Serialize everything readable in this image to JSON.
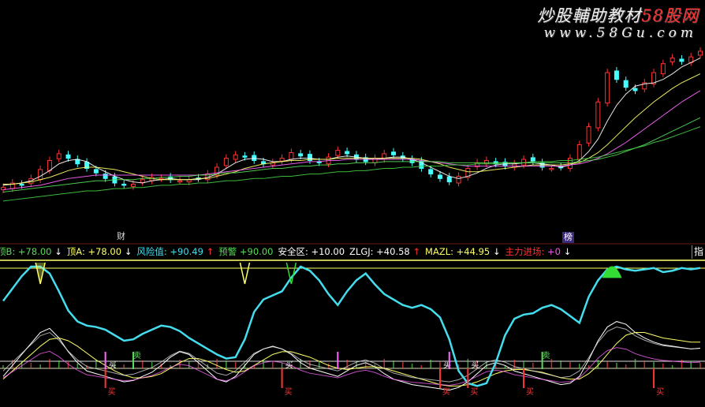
{
  "watermark": {
    "title_main": "炒股輔助教材",
    "title_accent": "58股网",
    "url": "www.58Gu.com"
  },
  "markers": {
    "cai": "财",
    "bang": "榜"
  },
  "indicator_bar": {
    "items": [
      {
        "label": "顶B:",
        "value": "+78.00",
        "arrow": "↓",
        "color": "#55dd55",
        "value_color": "#55dd55",
        "arrow_color": "#ffffff"
      },
      {
        "label": "顶A:",
        "value": "+78.00",
        "arrow": "↓",
        "color": "#ffff66",
        "value_color": "#ffff66",
        "arrow_color": "#ffffff"
      },
      {
        "label": "风险值:",
        "value": "+90.49",
        "arrow": "↑",
        "color": "#44ddee",
        "value_color": "#44ddee",
        "arrow_color": "#ff3333"
      },
      {
        "label": "预警",
        "value": "+90.00",
        "arrow": "",
        "color": "#55dd55",
        "value_color": "#55dd55",
        "arrow_color": ""
      },
      {
        "label": "安全区:",
        "value": "+10.00",
        "arrow": "",
        "color": "#ffffff",
        "value_color": "#ffffff",
        "arrow_color": ""
      },
      {
        "label": "ZLGJ:",
        "value": "+40.58",
        "arrow": "↑",
        "color": "#ffffff",
        "value_color": "#ffffff",
        "arrow_color": "#ff3333"
      },
      {
        "label": "MAZL:",
        "value": "+44.95",
        "arrow": "↓",
        "color": "#ffff66",
        "value_color": "#ffff66",
        "arrow_color": "#ffffff"
      },
      {
        "label": "主力进场:",
        "value": "+0",
        "arrow": "↓",
        "color": "#ff3333",
        "value_color": "#ff55ff",
        "arrow_color": "#ffffff"
      }
    ],
    "right_tab": "指"
  },
  "signal_labels": {
    "buy": "买",
    "sell": "卖"
  },
  "colors": {
    "up": "#ff3333",
    "down": "#44ffff",
    "ma5": "#ffffff",
    "ma10": "#ffff66",
    "ma20": "#ff66ff",
    "ma30": "#55dd55",
    "ma60": "#44cc44",
    "risk": "#44ddee",
    "threshold_line": "#ffff66"
  },
  "chart_data": [
    {
      "type": "candlestick",
      "title": "",
      "series": [
        {
          "name": "price",
          "values": [
            10.2,
            10.6,
            10.4,
            11.0,
            11.8,
            12.6,
            13.2,
            12.8,
            12.3,
            11.9,
            11.5,
            11.0,
            10.6,
            10.4,
            10.5,
            10.9,
            11.1,
            11.0,
            10.9,
            10.8,
            10.9,
            11.0,
            11.4,
            12.0,
            12.8,
            13.1,
            12.9,
            12.6,
            12.3,
            12.4,
            12.8,
            13.3,
            13.0,
            12.6,
            12.4,
            12.9,
            13.5,
            13.2,
            12.7,
            12.5,
            12.8,
            13.2,
            13.1,
            12.8,
            12.4,
            11.9,
            11.4,
            11.0,
            10.7,
            11.2,
            11.9,
            12.4,
            12.6,
            12.3,
            12.1,
            12.3,
            12.7,
            12.5,
            12.0,
            11.9,
            12.0,
            12.8,
            14.0,
            15.6,
            17.8,
            20.4,
            19.8,
            19.1,
            18.8,
            19.5,
            20.4,
            21.2,
            21.7,
            21.4,
            21.8,
            22.3
          ]
        },
        {
          "name": "MA5",
          "values": [
            10.4,
            10.5,
            10.6,
            10.8,
            11.2,
            11.7,
            12.3,
            12.6,
            12.7,
            12.5,
            12.0,
            11.6,
            11.2,
            10.9,
            10.7,
            10.6,
            10.8,
            10.9,
            11.0,
            10.9,
            10.9,
            10.9,
            11.1,
            11.4,
            11.9,
            12.4,
            12.7,
            12.8,
            12.7,
            12.5,
            12.5,
            12.7,
            12.8,
            12.8,
            12.7,
            12.7,
            12.9,
            13.0,
            12.9,
            12.8,
            12.7,
            12.8,
            12.9,
            12.9,
            12.7,
            12.4,
            12.0,
            11.6,
            11.2,
            11.0,
            11.2,
            11.5,
            11.9,
            12.2,
            12.3,
            12.3,
            12.4,
            12.4,
            12.3,
            12.2,
            12.0,
            12.2,
            12.6,
            13.4,
            14.5,
            16.1,
            17.5,
            18.5,
            19.2,
            19.4,
            19.5,
            19.8,
            20.3,
            20.9,
            21.3,
            21.7
          ]
        },
        {
          "name": "MA10",
          "values": [
            10.5,
            10.5,
            10.6,
            10.7,
            10.9,
            11.1,
            11.4,
            11.7,
            11.9,
            12.0,
            12.0,
            11.9,
            11.8,
            11.6,
            11.4,
            11.2,
            11.0,
            10.9,
            10.9,
            10.9,
            10.9,
            11.0,
            11.0,
            11.2,
            11.4,
            11.6,
            11.9,
            12.1,
            12.3,
            12.4,
            12.5,
            12.6,
            12.6,
            12.7,
            12.7,
            12.7,
            12.8,
            12.8,
            12.8,
            12.8,
            12.8,
            12.8,
            12.8,
            12.8,
            12.8,
            12.7,
            12.5,
            12.3,
            12.0,
            11.8,
            11.6,
            11.6,
            11.7,
            11.8,
            11.9,
            12.0,
            12.1,
            12.2,
            12.2,
            12.2,
            12.2,
            12.3,
            12.4,
            12.8,
            13.3,
            14.0,
            14.8,
            15.6,
            16.4,
            17.1,
            17.8,
            18.4,
            19.0,
            19.5,
            19.9,
            20.3
          ]
        },
        {
          "name": "MA20",
          "values": [
            10.0,
            10.1,
            10.2,
            10.3,
            10.4,
            10.6,
            10.8,
            11.0,
            11.1,
            11.2,
            11.3,
            11.3,
            11.3,
            11.3,
            11.3,
            11.3,
            11.3,
            11.3,
            11.3,
            11.3,
            11.3,
            11.3,
            11.4,
            11.5,
            11.6,
            11.7,
            11.8,
            11.9,
            12.0,
            12.1,
            12.2,
            12.3,
            12.4,
            12.5,
            12.5,
            12.6,
            12.6,
            12.7,
            12.7,
            12.7,
            12.7,
            12.7,
            12.7,
            12.7,
            12.7,
            12.6,
            12.5,
            12.4,
            12.3,
            12.2,
            12.1,
            12.1,
            12.1,
            12.1,
            12.1,
            12.1,
            12.1,
            12.1,
            12.1,
            12.1,
            12.1,
            12.2,
            12.3,
            12.5,
            12.8,
            13.2,
            13.7,
            14.2,
            14.8,
            15.4,
            16.0,
            16.6,
            17.2,
            17.8,
            18.3,
            18.8
          ]
        },
        {
          "name": "MA30",
          "values": [
            9.8,
            9.9,
            10.0,
            10.1,
            10.2,
            10.3,
            10.4,
            10.5,
            10.6,
            10.7,
            10.8,
            10.8,
            10.9,
            10.9,
            10.9,
            11.0,
            11.0,
            11.1,
            11.1,
            11.2,
            11.2,
            11.3,
            11.3,
            11.4,
            11.5,
            11.5,
            11.6,
            11.7,
            11.8,
            11.9,
            11.9,
            12.0,
            12.1,
            12.1,
            12.2,
            12.2,
            12.3,
            12.3,
            12.4,
            12.4,
            12.4,
            12.5,
            12.5,
            12.5,
            12.5,
            12.5,
            12.5,
            12.5,
            12.4,
            12.4,
            12.4,
            12.4,
            12.4,
            12.4,
            12.4,
            12.4,
            12.4,
            12.4,
            12.4,
            12.4,
            12.4,
            12.4,
            12.5,
            12.6,
            12.7,
            12.9,
            13.1,
            13.4,
            13.7,
            14.0,
            14.4,
            14.8,
            15.2,
            15.6,
            16.0,
            16.4
          ]
        },
        {
          "name": "MA60",
          "values": [
            9.0,
            9.1,
            9.2,
            9.3,
            9.4,
            9.5,
            9.6,
            9.7,
            9.8,
            9.9,
            9.9,
            10.0,
            10.1,
            10.1,
            10.2,
            10.2,
            10.3,
            10.4,
            10.4,
            10.5,
            10.5,
            10.6,
            10.6,
            10.7,
            10.8,
            10.8,
            10.9,
            11.0,
            11.0,
            11.1,
            11.2,
            11.2,
            11.3,
            11.4,
            11.4,
            11.5,
            11.6,
            11.6,
            11.7,
            11.7,
            11.8,
            11.9,
            11.9,
            12.0,
            12.0,
            12.1,
            12.1,
            12.1,
            12.2,
            12.2,
            12.2,
            12.3,
            12.3,
            12.3,
            12.4,
            12.4,
            12.4,
            12.5,
            12.5,
            12.5,
            12.6,
            12.6,
            12.7,
            12.8,
            12.9,
            13.1,
            13.3,
            13.5,
            13.7,
            13.9,
            14.2,
            14.4,
            14.7,
            15.0,
            15.3,
            15.6
          ]
        }
      ]
    },
    {
      "type": "line",
      "title": "",
      "ylim": [
        0,
        100
      ],
      "series": [
        {
          "name": "风险值",
          "values": [
            75,
            84,
            93,
            100,
            100,
            95,
            82,
            68,
            60,
            57,
            56,
            54,
            50,
            46,
            47,
            51,
            54,
            57,
            56,
            53,
            48,
            44,
            40,
            36,
            33,
            34,
            47,
            67,
            76,
            79,
            82,
            92,
            100,
            97,
            90,
            80,
            72,
            82,
            90,
            95,
            87,
            80,
            76,
            72,
            70,
            72,
            69,
            63,
            47,
            24,
            15,
            13,
            15,
            30,
            50,
            62,
            65,
            66,
            70,
            72,
            69,
            64,
            59,
            78,
            90,
            98,
            100,
            98,
            97,
            98,
            99,
            96,
            97,
            99,
            98,
            99
          ]
        },
        {
          "name": "ZLGJ",
          "values": [
            20,
            28,
            36,
            44,
            52,
            55,
            48,
            38,
            30,
            24,
            22,
            20,
            18,
            16,
            17,
            20,
            23,
            28,
            34,
            38,
            36,
            30,
            24,
            18,
            16,
            20,
            28,
            36,
            40,
            42,
            40,
            36,
            30,
            26,
            24,
            22,
            20,
            24,
            28,
            30,
            27,
            22,
            18,
            16,
            14,
            13,
            12,
            11,
            10,
            12,
            16,
            22,
            28,
            30,
            28,
            24,
            22,
            20,
            18,
            16,
            14,
            15,
            20,
            32,
            46,
            56,
            60,
            58,
            52,
            48,
            45,
            43,
            42,
            41,
            40,
            40.58
          ]
        },
        {
          "name": "MAZL",
          "values": [
            18,
            24,
            30,
            36,
            42,
            47,
            48,
            46,
            42,
            37,
            32,
            28,
            24,
            21,
            19,
            19,
            20,
            22,
            26,
            30,
            33,
            33,
            31,
            28,
            25,
            23,
            24,
            28,
            32,
            36,
            38,
            38,
            36,
            34,
            31,
            28,
            26,
            25,
            26,
            27,
            27,
            26,
            24,
            22,
            20,
            18,
            16,
            14,
            13,
            13,
            14,
            16,
            19,
            22,
            24,
            25,
            25,
            24,
            23,
            21,
            19,
            18,
            18,
            22,
            28,
            36,
            44,
            50,
            52,
            52,
            50,
            48,
            47,
            46,
            45,
            44.95
          ]
        }
      ],
      "reference_lines": {
        "预警": 90,
        "安全区": 10,
        "顶": 78
      },
      "sell_signal_x": [
        4,
        26,
        31
      ],
      "buy_signal_x": [
        11,
        30,
        47,
        50,
        56,
        70
      ]
    }
  ]
}
